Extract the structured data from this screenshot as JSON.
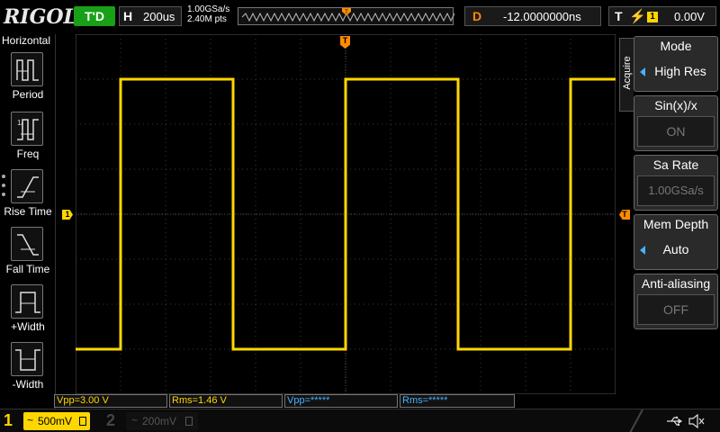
{
  "brand": "RIGOL",
  "status": {
    "trigger_state": "T'D"
  },
  "horizontal": {
    "label": "H",
    "timebase": "200us",
    "sample_rate": "1.00GSa/s",
    "memory_points": "2.40M pts"
  },
  "delay": {
    "label": "D",
    "value": "-12.0000000ns"
  },
  "trigger": {
    "label": "T",
    "slope_icon": "rising-edge-icon",
    "source": "1",
    "level": "0.00V"
  },
  "left_menu": {
    "title": "Horizontal",
    "items": [
      {
        "label": "Period",
        "icon": "period-icon"
      },
      {
        "label": "Freq",
        "icon": "freq-icon"
      },
      {
        "label": "Rise Time",
        "icon": "rise-time-icon"
      },
      {
        "label": "Fall Time",
        "icon": "fall-time-icon"
      },
      {
        "label": "+Width",
        "icon": "plus-width-icon"
      },
      {
        "label": "-Width",
        "icon": "minus-width-icon"
      }
    ]
  },
  "markers": {
    "ch1": "1",
    "trigger_level": "T",
    "trigger_position": "T"
  },
  "right_menu": {
    "tab": "Acquire",
    "items": [
      {
        "title": "Mode",
        "value": "High Res",
        "enabled": true,
        "has_arrow": true
      },
      {
        "title": "Sin(x)/x",
        "value": "ON",
        "enabled": false,
        "has_arrow": false
      },
      {
        "title": "Sa Rate",
        "value": "1.00GSa/s",
        "enabled": false,
        "has_arrow": false
      },
      {
        "title": "Mem Depth",
        "value": "Auto",
        "enabled": true,
        "has_arrow": true
      },
      {
        "title": "Anti-aliasing",
        "value": "OFF",
        "enabled": false,
        "has_arrow": false
      }
    ]
  },
  "measurements": [
    {
      "text": "Vpp=3.00 V",
      "active": true
    },
    {
      "text": "Rms=1.46 V",
      "active": true
    },
    {
      "text": "Vpp=*****",
      "active": false
    },
    {
      "text": "Rms=*****",
      "active": false
    }
  ],
  "channels": [
    {
      "number": "1",
      "coupling": "~",
      "scale": "500mV",
      "active": true
    },
    {
      "number": "2",
      "coupling": "~",
      "scale": "200mV",
      "active": false
    }
  ],
  "colors": {
    "ch1": "#ffd700",
    "trigger": "#ff8c00",
    "grid": "#3a3a3a",
    "accent": "#4ab2ff",
    "status_green": "#18a018"
  },
  "waveform": {
    "type": "square",
    "ch1_vpp": 3.0,
    "ch1_rms": 1.46,
    "duty_cycle": 0.5,
    "divisions_per_period": 5.0
  }
}
